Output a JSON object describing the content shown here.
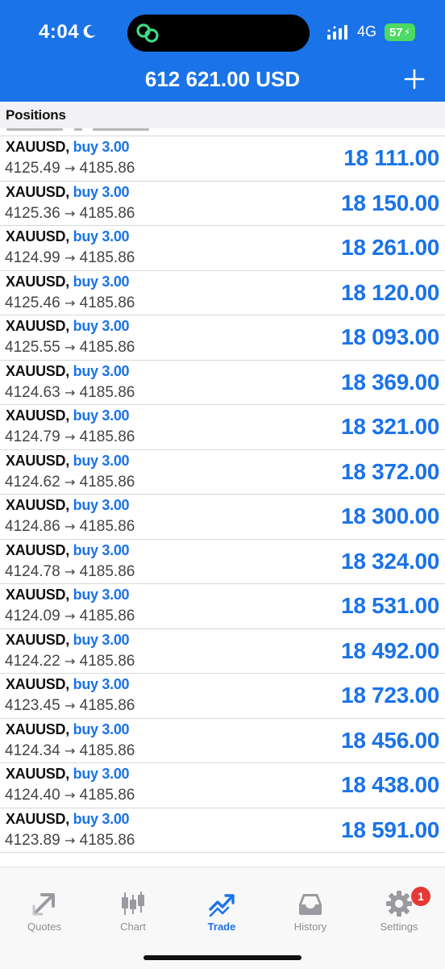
{
  "status_bar": {
    "time": "4:04",
    "network": "4G",
    "battery": "57"
  },
  "header": {
    "balance": "612 621.00 USD"
  },
  "section": {
    "title": "Positions"
  },
  "positions": [
    {
      "symbol": "XAUUSD",
      "side": "buy 3.00",
      "open": "4125.49",
      "current": "4185.86",
      "profit": "18 111.00"
    },
    {
      "symbol": "XAUUSD",
      "side": "buy 3.00",
      "open": "4125.36",
      "current": "4185.86",
      "profit": "18 150.00"
    },
    {
      "symbol": "XAUUSD",
      "side": "buy 3.00",
      "open": "4124.99",
      "current": "4185.86",
      "profit": "18 261.00"
    },
    {
      "symbol": "XAUUSD",
      "side": "buy 3.00",
      "open": "4125.46",
      "current": "4185.86",
      "profit": "18 120.00"
    },
    {
      "symbol": "XAUUSD",
      "side": "buy 3.00",
      "open": "4125.55",
      "current": "4185.86",
      "profit": "18 093.00"
    },
    {
      "symbol": "XAUUSD",
      "side": "buy 3.00",
      "open": "4124.63",
      "current": "4185.86",
      "profit": "18 369.00"
    },
    {
      "symbol": "XAUUSD",
      "side": "buy 3.00",
      "open": "4124.79",
      "current": "4185.86",
      "profit": "18 321.00"
    },
    {
      "symbol": "XAUUSD",
      "side": "buy 3.00",
      "open": "4124.62",
      "current": "4185.86",
      "profit": "18 372.00"
    },
    {
      "symbol": "XAUUSD",
      "side": "buy 3.00",
      "open": "4124.86",
      "current": "4185.86",
      "profit": "18 300.00"
    },
    {
      "symbol": "XAUUSD",
      "side": "buy 3.00",
      "open": "4124.78",
      "current": "4185.86",
      "profit": "18 324.00"
    },
    {
      "symbol": "XAUUSD",
      "side": "buy 3.00",
      "open": "4124.09",
      "current": "4185.86",
      "profit": "18 531.00"
    },
    {
      "symbol": "XAUUSD",
      "side": "buy 3.00",
      "open": "4124.22",
      "current": "4185.86",
      "profit": "18 492.00"
    },
    {
      "symbol": "XAUUSD",
      "side": "buy 3.00",
      "open": "4123.45",
      "current": "4185.86",
      "profit": "18 723.00"
    },
    {
      "symbol": "XAUUSD",
      "side": "buy 3.00",
      "open": "4124.34",
      "current": "4185.86",
      "profit": "18 456.00"
    },
    {
      "symbol": "XAUUSD",
      "side": "buy 3.00",
      "open": "4124.40",
      "current": "4185.86",
      "profit": "18 438.00"
    },
    {
      "symbol": "XAUUSD",
      "side": "buy 3.00",
      "open": "4123.89",
      "current": "4185.86",
      "profit": "18 591.00"
    }
  ],
  "tabs": [
    {
      "label": "Quotes",
      "icon": "quotes-arrow-icon",
      "active": false
    },
    {
      "label": "Chart",
      "icon": "candlestick-icon",
      "active": false
    },
    {
      "label": "Trade",
      "icon": "trade-trend-icon",
      "active": true
    },
    {
      "label": "History",
      "icon": "inbox-tray-icon",
      "active": false
    },
    {
      "label": "Settings",
      "icon": "gear-icon",
      "active": false,
      "badge": "1"
    }
  ],
  "colors": {
    "brand_blue": "#1a73e8",
    "tab_inactive": "#8e8e93",
    "badge_red": "#e53935",
    "battery_green": "#4cd964"
  }
}
